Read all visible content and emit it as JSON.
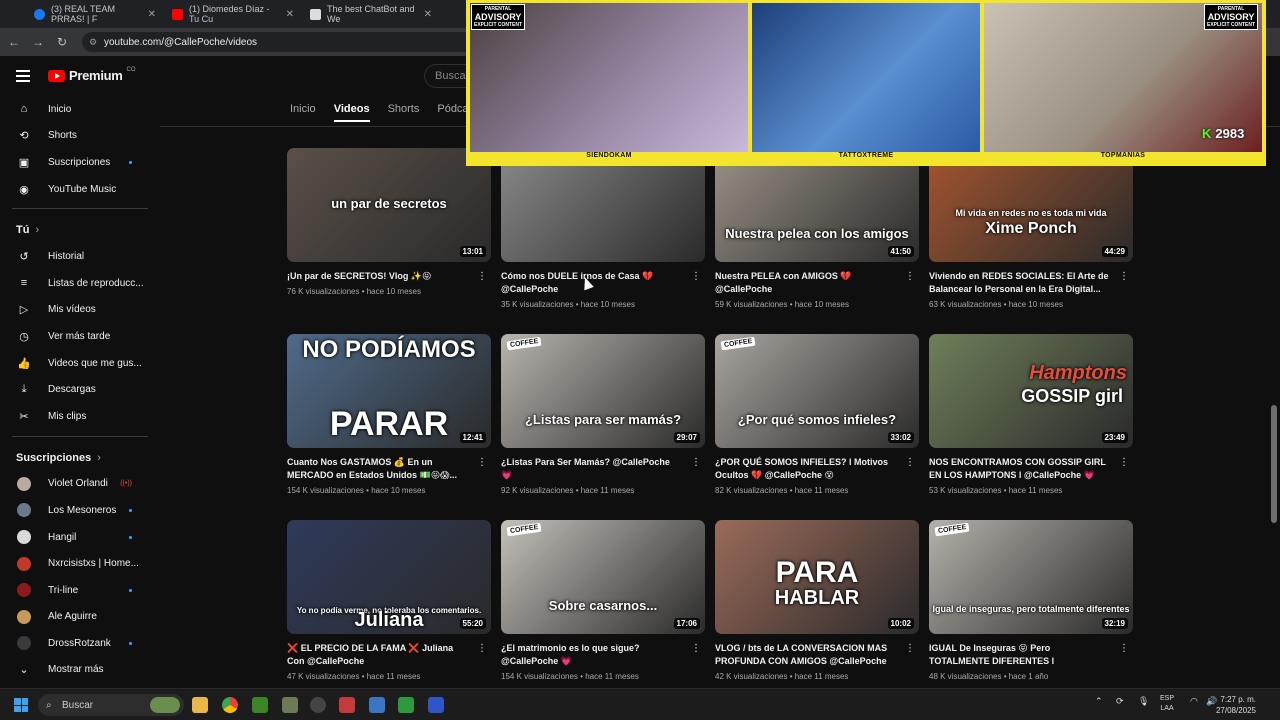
{
  "browser": {
    "tabs": [
      {
        "label": "(3) REAL TEAM PRRAS! | F",
        "icon": "facebook-icon",
        "color": "#1877f2"
      },
      {
        "label": "(1) Diomedes Díaz - Tu Cu",
        "icon": "youtube-icon",
        "color": "#ff0000"
      },
      {
        "label": "The best ChatBot and We",
        "icon": "chatbot-icon",
        "color": "#ffffff"
      }
    ],
    "url": "youtube.com/@CallePoche/videos"
  },
  "youtube": {
    "logo": "Premium",
    "logo_country": "CO",
    "search_placeholder": "Busca",
    "channel_tabs": [
      "Inicio",
      "Videos",
      "Shorts",
      "Pódcas"
    ]
  },
  "sidebar": {
    "main": [
      {
        "label": "Inicio",
        "icon": "home-icon"
      },
      {
        "label": "Shorts",
        "icon": "shorts-icon"
      },
      {
        "label": "Suscripciones",
        "icon": "subscriptions-icon",
        "dot": true
      },
      {
        "label": "YouTube Music",
        "icon": "music-icon"
      }
    ],
    "you_header": "Tú",
    "you": [
      {
        "label": "Historial",
        "icon": "history-icon"
      },
      {
        "label": "Listas de reproducc...",
        "icon": "playlist-icon"
      },
      {
        "label": "Mis vídeos",
        "icon": "my-videos-icon"
      },
      {
        "label": "Ver más tarde",
        "icon": "watch-later-icon"
      },
      {
        "label": "Videos que me gus...",
        "icon": "like-icon"
      },
      {
        "label": "Descargas",
        "icon": "download-icon"
      },
      {
        "label": "Mis clips",
        "icon": "clips-icon"
      }
    ],
    "subs_header": "Suscripciones",
    "subs": [
      {
        "label": "Violet Orlandi",
        "color": "#b9a9a0",
        "live": true
      },
      {
        "label": "Los Mesoneros",
        "color": "#6a7a8a",
        "dot": true
      },
      {
        "label": "Hangil",
        "color": "#d9d9d9",
        "dot": true
      },
      {
        "label": "Nxrcisistxs | Home...",
        "color": "#c0392b",
        "dot": false
      },
      {
        "label": "Tri-line",
        "color": "#8b1a1a",
        "dot": true
      },
      {
        "label": "Ale Aguirre",
        "color": "#c79a5c",
        "dot": false
      },
      {
        "label": "DrossRotzank",
        "color": "#3a3a3a",
        "dot": true
      }
    ],
    "more_label": "Mostrar más"
  },
  "stream": {
    "cams": [
      "SIENDOKAM",
      "TATTOXTREME",
      "TOPMANIAS"
    ],
    "advisory_top": "PARENTAL",
    "advisory_main": "ADVISORY",
    "advisory_bottom": "EXPLICIT CONTENT",
    "viewer_count": "2983"
  },
  "videos": [
    {
      "title": "¡Un par de SECRETOS! Vlog ✨😝",
      "views": "76 K visualizaciones",
      "age": "hace 10 meses",
      "duration": "13:01",
      "overlay": "un par de secretos",
      "bg": "#5a5048"
    },
    {
      "title": "Cómo nos DUELE irnos de Casa 💔 @CallePoche",
      "views": "35 K visualizaciones",
      "age": "hace 10 meses",
      "duration": "",
      "overlay": "",
      "bg": "#8a8a8a"
    },
    {
      "title": "Nuestra PELEA con AMIGOS 💔 @CallePoche",
      "views": "59 K visualizaciones",
      "age": "hace 10 meses",
      "duration": "41:50",
      "overlay": "Nuestra pelea con los amigos",
      "bg": "#9a9286"
    },
    {
      "title": "Viviendo en REDES SOCIALES: El Arte de Balancear lo Personal en la Era Digital...",
      "views": "63 K visualizaciones",
      "age": "hace 10 meses",
      "duration": "44:29",
      "overlay": "Mi vida en redes no es toda mi vida",
      "overlay2": "Xime Ponch",
      "bg": "#a4552f"
    },
    {
      "title": "Cuanto Nos GASTAMOS 💰 En un MERCADO en Estados Unidos 💵😝😱...",
      "views": "154 K visualizaciones",
      "age": "hace 10 meses",
      "duration": "12:41",
      "overlay": "NO PODÍAMOS",
      "overlay2": "PARAR",
      "bg": "#4f6b8a"
    },
    {
      "title": "¿Listas Para Ser Mamás? @CallePoche 💗",
      "views": "92 K visualizaciones",
      "age": "hace 11 meses",
      "duration": "29:07",
      "overlay": "¿Listas para ser mamás?",
      "bg": "#b8b4ae"
    },
    {
      "title": "¿POR QUÉ SOMOS INFIELES? l Motivos Ocultos 💔 @CallePoche 😵",
      "views": "82 K visualizaciones",
      "age": "hace 11 meses",
      "duration": "33:02",
      "overlay": "¿Por qué somos infieles?",
      "bg": "#a9a59f"
    },
    {
      "title": "NOS ENCONTRAMOS CON GOSSIP GIRL EN LOS HAMPTONS l @CallePoche 💗",
      "views": "53 K visualizaciones",
      "age": "hace 11 meses",
      "duration": "23:49",
      "overlay": "Hamptons",
      "overlay2": "GOSSIP girl",
      "bg": "#6f7f5a"
    },
    {
      "title": "❌ EL PRECIO DE LA FAMA ❌ Juliana Con @CallePoche",
      "views": "47 K visualizaciones",
      "age": "hace 11 meses",
      "duration": "55:20",
      "overlay": "Yo no podía verme, no toleraba los comentarios.",
      "overlay2": "Juliana",
      "bg": "#2f3a5a"
    },
    {
      "title": "¿El matrimonio es lo que sigue? @CallePoche 💗",
      "views": "154 K visualizaciones",
      "age": "hace 11 meses",
      "duration": "17:06",
      "overlay": "Sobre casarnos...",
      "bg": "#c4c0ba"
    },
    {
      "title": "VLOG / bts de LA CONVERSACION MAS PROFUNDA CON AMIGOS @CallePoche ❌...",
      "views": "42 K visualizaciones",
      "age": "hace 11 meses",
      "duration": "10:02",
      "overlay": "PARA",
      "overlay2": "HABLAR",
      "bg": "#9b6b5a"
    },
    {
      "title": "IGUAL De Inseguras 😝 Pero TOTALMENTE DIFERENTES l @CallePoche Coffee...",
      "views": "48 K visualizaciones",
      "age": "hace 1 año",
      "duration": "32:19",
      "overlay": "Igual de inseguras, pero totalmente diferentes",
      "bg": "#b5b1aa"
    }
  ],
  "taskbar": {
    "search_placeholder": "Buscar",
    "lang_1": "ESP",
    "lang_2": "LAA",
    "time": "7:27 p. m.",
    "date": "27/08/2025"
  }
}
